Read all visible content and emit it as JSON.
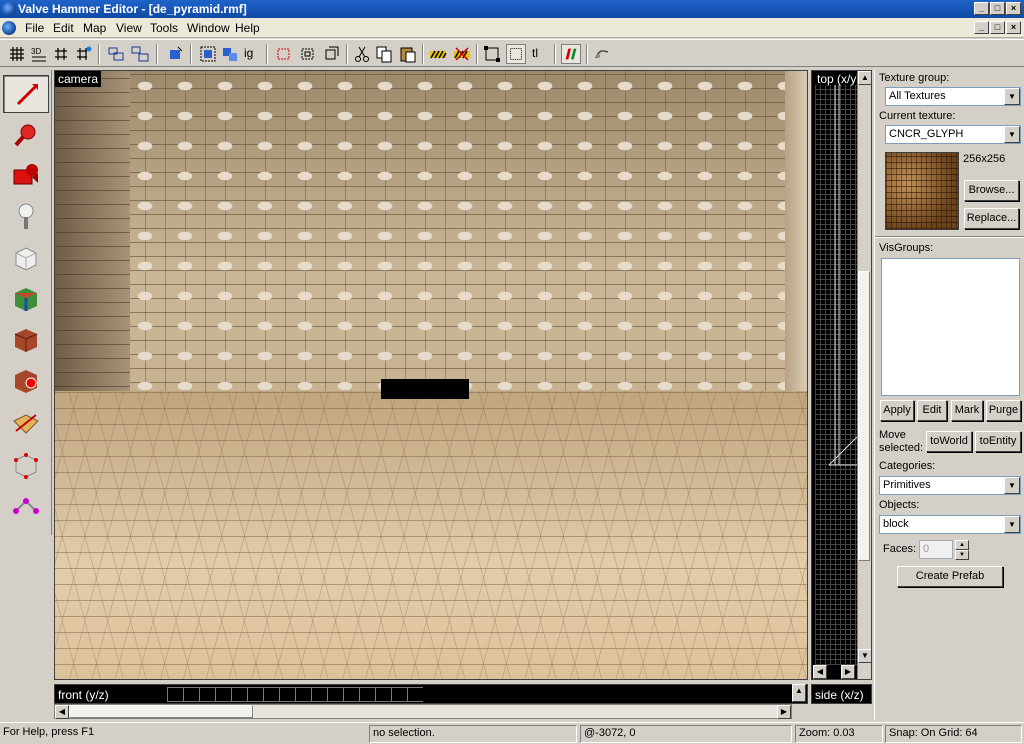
{
  "window": {
    "title": "Valve Hammer Editor - [de_pyramid.rmf]",
    "controls": [
      "_",
      "□",
      "×"
    ]
  },
  "menu": {
    "items": [
      "File",
      "Edit",
      "Map",
      "View",
      "Tools",
      "Window",
      "Help"
    ]
  },
  "toolbar": {
    "icons": [
      "grid-toggle-icon",
      "3d-grid-icon",
      "grid-smaller-icon",
      "grid-larger-icon",
      "group-icon",
      "ungroup-icon",
      "to-entity-icon",
      "hide-icon",
      "show-icon",
      "ignore-groups-icon",
      "carve-icon",
      "hollow-icon",
      "clip-icon",
      "cut-icon",
      "copy-icon",
      "paste-icon",
      "texture-lock-icon",
      "texture-apply-icon",
      "selection-box-icon",
      "select-by-handle-icon",
      "texture-label-icon",
      "compile-icon",
      "run-map-icon"
    ],
    "texture_label": "tl",
    "ignore_label": "ig"
  },
  "tools": [
    "selection-tool-icon",
    "magnify-tool-icon",
    "camera-tool-icon",
    "entity-tool-icon",
    "block-tool-icon",
    "texture-application-icon",
    "apply-current-texture-icon",
    "decal-tool-icon",
    "clipping-tool-icon",
    "vertex-manipulation-icon",
    "path-tool-icon"
  ],
  "viewports": {
    "camera": "camera",
    "top": "top (x/y)",
    "front": "front (y/z)",
    "side": "side (x/z)"
  },
  "panel": {
    "texture_group_label": "Texture group:",
    "texture_group_value": "All Textures",
    "current_texture_label": "Current texture:",
    "current_texture_value": "CNCR_GLYPH",
    "texture_size": "256x256",
    "browse_label": "Browse...",
    "replace_label": "Replace...",
    "visgroups_label": "VisGroups:",
    "apply_label": "Apply",
    "edit_label": "Edit",
    "mark_label": "Mark",
    "purge_label": "Purge",
    "move_selected_label_1": "Move",
    "move_selected_label_2": "selected:",
    "to_world_label": "toWorld",
    "to_entity_label": "toEntity",
    "categories_label": "Categories:",
    "categories_value": "Primitives",
    "objects_label": "Objects:",
    "objects_value": "block",
    "faces_label": "Faces:",
    "faces_value": "0",
    "create_prefab_label": "Create Prefab"
  },
  "status": {
    "help": "For Help, press F1",
    "selection": "no selection.",
    "coords": "@-3072, 0",
    "zoom": "Zoom: 0.03",
    "snap": "Snap: On Grid: 64"
  }
}
